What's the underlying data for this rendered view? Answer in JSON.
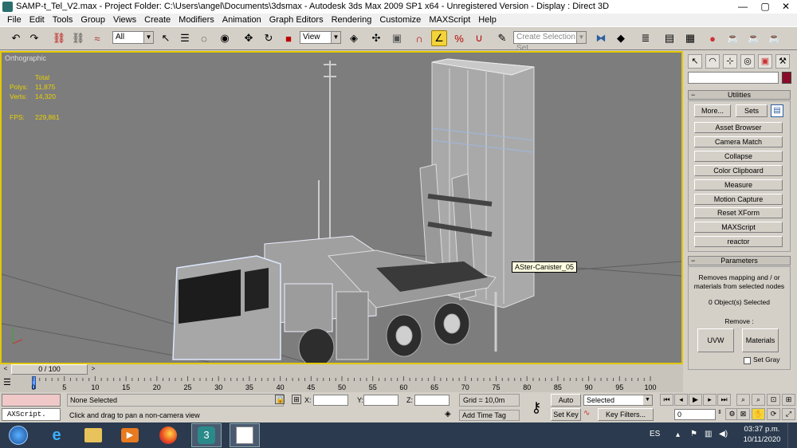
{
  "window": {
    "title": "SAMP-t_Tel_V2.max    - Project Folder: C:\\Users\\angel\\Documents\\3dsmax    - Autodesk 3ds Max  2009 SP1  x64   - Unregistered Version     - Display : Direct 3D",
    "minimize": "—",
    "maximize": "▢",
    "close": "✕"
  },
  "menu": [
    "File",
    "Edit",
    "Tools",
    "Group",
    "Views",
    "Create",
    "Modifiers",
    "Animation",
    "Graph Editors",
    "Rendering",
    "Customize",
    "MAXScript",
    "Help"
  ],
  "toolbar": {
    "selection_filter": "All",
    "ref_coord": "View",
    "named_selection_placeholder": "Create Selection Set"
  },
  "viewport": {
    "label": "Orthographic",
    "stats": {
      "total_label": "Total",
      "polys_label": "Polys:",
      "polys_value": "11,875",
      "verts_label": "Verts:",
      "verts_value": "14,320",
      "fps_label": "FPS:",
      "fps_value": "229,861"
    },
    "tooltip": "ASter-Canister_05"
  },
  "command_panel": {
    "utilities_header": "Utilities",
    "more_button": "More...",
    "sets_button": "Sets",
    "utilities": [
      "Asset Browser",
      "Camera Match",
      "Collapse",
      "Color Clipboard",
      "Measure",
      "Motion Capture",
      "Reset XForm",
      "MAXScript",
      "reactor"
    ],
    "parameters_header": "Parameters",
    "description": "Removes mapping and / or materials from selected nodes",
    "selected_count": "0 Object(s) Selected",
    "remove_label": "Remove :",
    "uvw_button": "UVW",
    "materials_button": "Materials",
    "set_gray_label": "Set Gray",
    "accent_color": "#8b0a2a"
  },
  "timeline": {
    "frame_display": "0 / 100",
    "ticks": [
      "0",
      "5",
      "10",
      "15",
      "20",
      "25",
      "30",
      "35",
      "40",
      "45",
      "50",
      "55",
      "60",
      "65",
      "70",
      "75",
      "80",
      "85",
      "90",
      "95",
      "100"
    ]
  },
  "status": {
    "selection": "None Selected",
    "prompt": "Click and drag to pan a non-camera view",
    "x_label": "X:",
    "y_label": "Y:",
    "z_label": "Z:",
    "grid": "Grid = 10,0m",
    "add_time_tag": "Add Time Tag",
    "auto_key": "Auto Key",
    "set_key": "Set Key",
    "key_mode": "Selected",
    "key_filters": "Key Filters...",
    "current_frame": "0",
    "maxscript": "AXScript."
  },
  "taskbar": {
    "language": "ES",
    "time": "03:37 p.m.",
    "date": "10/11/2020"
  }
}
